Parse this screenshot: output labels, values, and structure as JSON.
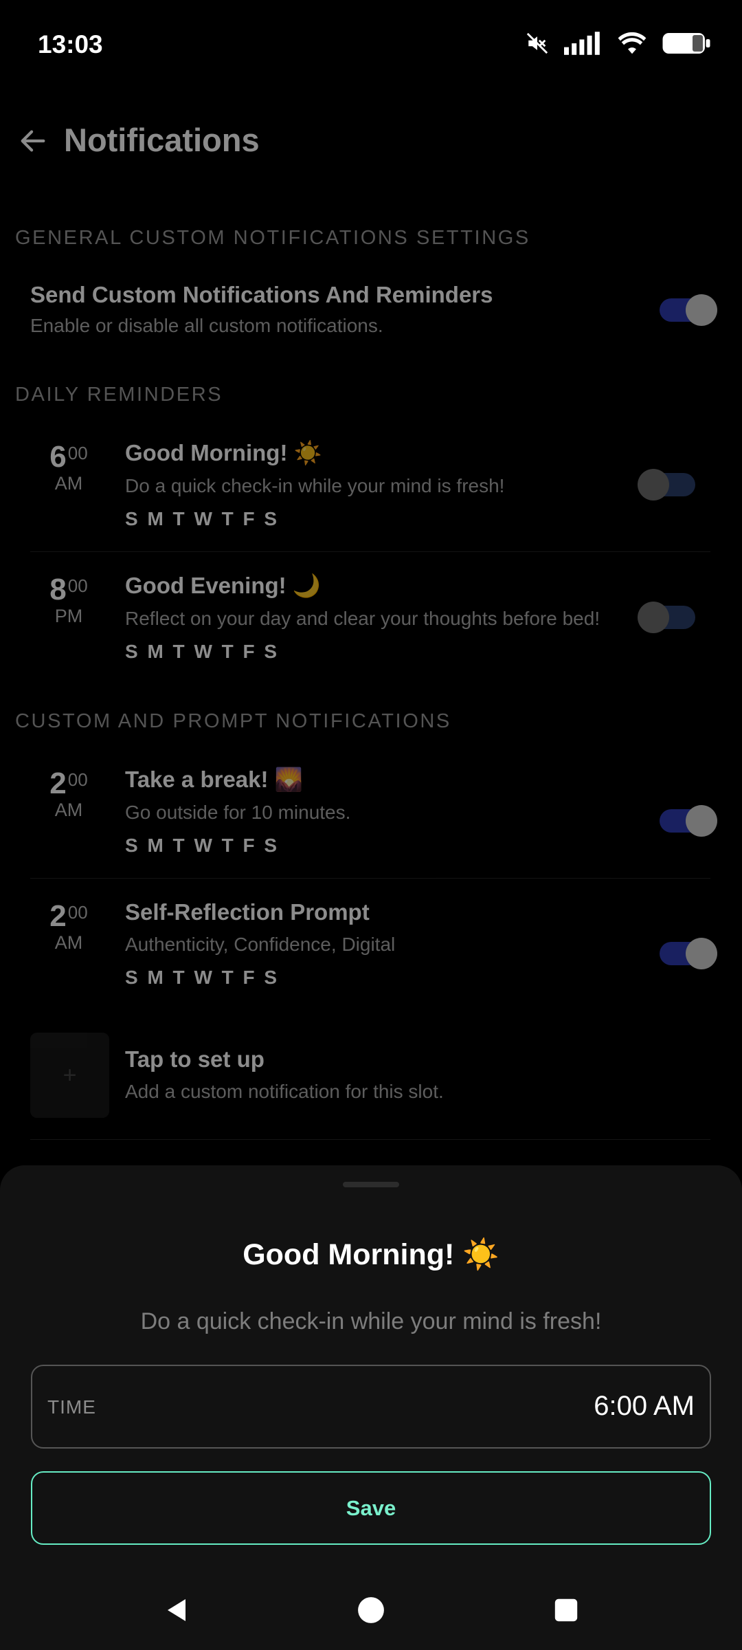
{
  "status_bar": {
    "time": "13:03"
  },
  "header": {
    "title": "Notifications"
  },
  "sections": {
    "general": "GENERAL CUSTOM NOTIFICATIONS SETTINGS",
    "daily": "DAILY REMINDERS",
    "custom": "CUSTOM AND PROMPT NOTIFICATIONS"
  },
  "general_setting": {
    "title": "Send Custom Notifications And Reminders",
    "subtitle": "Enable or disable all custom notifications.",
    "enabled": true
  },
  "daily_reminders": [
    {
      "hour": "6",
      "minutes": "00",
      "period": "AM",
      "title": "Good Morning! ☀️",
      "subtitle": "Do a quick check-in while your mind is fresh!",
      "days": "S M T W T F S",
      "enabled": false
    },
    {
      "hour": "8",
      "minutes": "00",
      "period": "PM",
      "title": "Good Evening! 🌙",
      "subtitle": "Reflect on your day and clear your thoughts before bed!",
      "days": "S M T W T F S",
      "enabled": false
    }
  ],
  "custom_notifications": [
    {
      "hour": "2",
      "minutes": "00",
      "period": "AM",
      "title": "Take a break! 🌄",
      "subtitle": "Go outside for 10 minutes.",
      "days": "S M T W T F S",
      "enabled": true
    },
    {
      "hour": "2",
      "minutes": "00",
      "period": "AM",
      "title": "Self-Reflection Prompt",
      "subtitle": "Authenticity, Confidence, Digital",
      "days": "S M T W T F S",
      "enabled": true
    }
  ],
  "empty_slot": {
    "icon": "+",
    "title": "Tap to set up",
    "subtitle": "Add a custom notification for this slot."
  },
  "sheet": {
    "title": "Good Morning! ☀️",
    "subtitle": "Do a quick check-in while your mind is fresh!",
    "time_label": "TIME",
    "time_value": "6:00 AM",
    "save_label": "Save"
  },
  "colors": {
    "accent": "#66ecc4",
    "toggle_on": "#2f3bb0",
    "background": "#000000",
    "sheet": "#121212"
  }
}
